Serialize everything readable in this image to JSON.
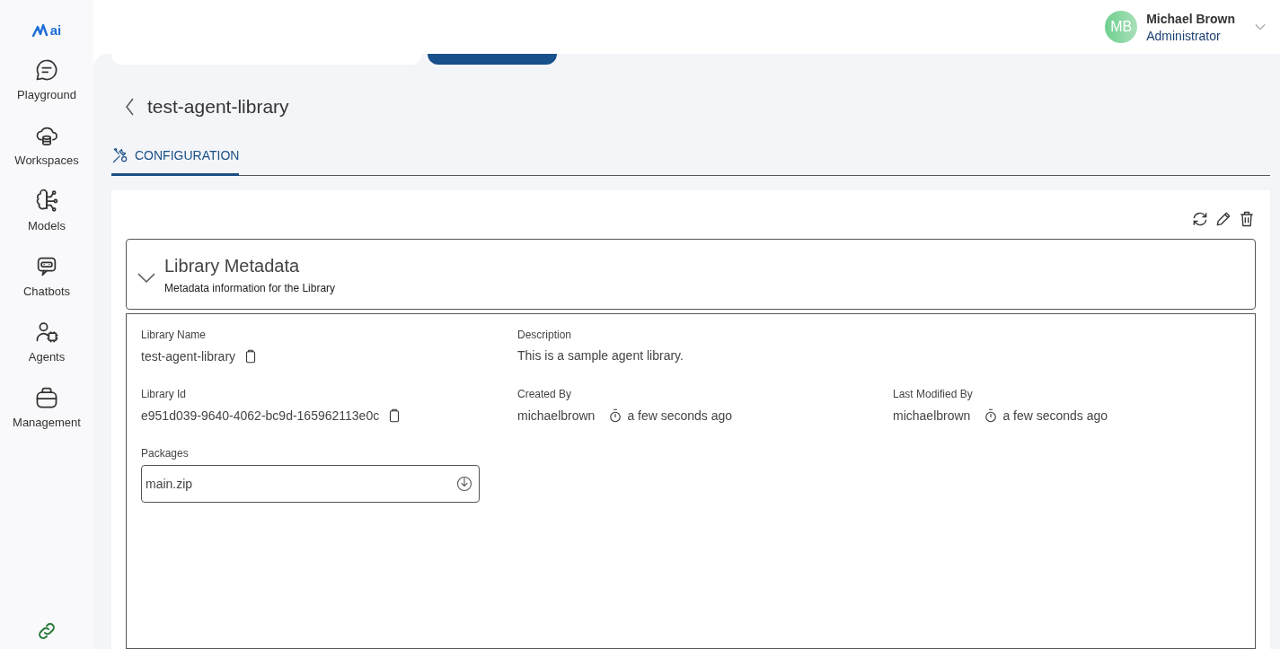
{
  "logo": {
    "text": "ai"
  },
  "sidebar": {
    "items": [
      {
        "label": "Playground"
      },
      {
        "label": "Workspaces"
      },
      {
        "label": "Models"
      },
      {
        "label": "Chatbots"
      },
      {
        "label": "Agents"
      },
      {
        "label": "Management"
      }
    ]
  },
  "user": {
    "initials": "MB",
    "name": "Michael Brown",
    "role": "Administrator"
  },
  "page": {
    "title": "test-agent-library"
  },
  "tabs": [
    {
      "label": "CONFIGURATION",
      "selected": true
    }
  ],
  "section": {
    "title": "Library Metadata",
    "subtitle": "Metadata information for the Library",
    "expanded": true
  },
  "fields": [
    {
      "label": "Library Name",
      "value": "test-agent-library",
      "kind": "copy"
    },
    {
      "label": "Description",
      "value": "This is a sample agent library.",
      "kind": "text"
    },
    {
      "kind": "blank"
    },
    {
      "label": "Library Id",
      "value": "e951d039-9640-4062-bc9d-165962113e0c",
      "kind": "copy"
    },
    {
      "label": "Created By",
      "value": "michaelbrown",
      "time": "a few seconds ago",
      "kind": "time"
    },
    {
      "label": "Last Modified By",
      "value": "michaelbrown",
      "time": "a few seconds ago",
      "kind": "time"
    }
  ],
  "packages": {
    "label": "Packages",
    "files": [
      "main.zip"
    ]
  }
}
